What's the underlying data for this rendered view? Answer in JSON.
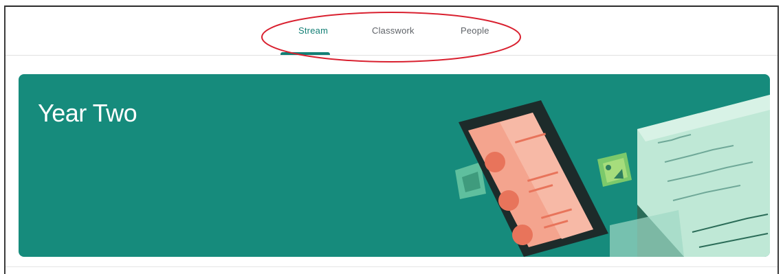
{
  "tabs": [
    {
      "label": "Stream",
      "active": true
    },
    {
      "label": "Classwork",
      "active": false
    },
    {
      "label": "People",
      "active": false
    }
  ],
  "class": {
    "title": "Year Two"
  },
  "colors": {
    "banner": "#168b7c",
    "accent": "#137f75",
    "annotation": "#d9202f"
  },
  "icons": {
    "illustration": "phone-and-notebook-illustration"
  }
}
